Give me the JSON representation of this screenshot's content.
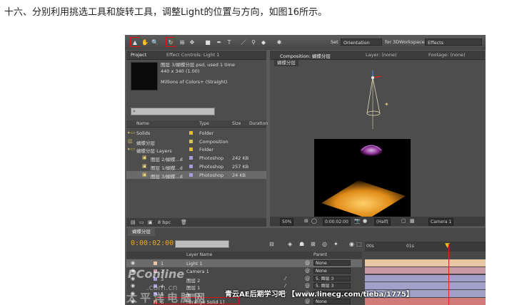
{
  "caption": "十六、分别利用挑选工具和旋转工具，调整Light的位置与方向，如图16所示。",
  "colors": {
    "accent_red": "#e01010",
    "timecode": "#e8a818",
    "layer_light": "#e8c7a4",
    "layer_camera": "#c89aa8",
    "layer_solid": "#d17a7a"
  },
  "toolbar": {
    "tools": [
      {
        "icon": "selection-tool-icon",
        "glyph": "▲",
        "highlighted": true
      },
      {
        "icon": "hand-tool-icon",
        "glyph": "✋",
        "highlighted": false
      },
      {
        "icon": "zoom-tool-icon",
        "glyph": "🔍",
        "highlighted": false
      },
      {
        "icon": "rotation-tool-icon",
        "glyph": "↻",
        "highlighted": true
      },
      {
        "icon": "camera-orbit-icon",
        "glyph": "⊞",
        "highlighted": false
      },
      {
        "icon": "pan-behind-icon",
        "glyph": "✥",
        "highlighted": false
      },
      {
        "icon": "rectangle-tool-icon",
        "glyph": "■",
        "highlighted": false
      },
      {
        "icon": "pen-tool-icon",
        "glyph": "✒",
        "highlighted": false
      },
      {
        "icon": "type-tool-icon",
        "glyph": "T",
        "highlighted": false
      },
      {
        "icon": "brush-tool-icon",
        "glyph": "／",
        "highlighted": false
      },
      {
        "icon": "clone-stamp-icon",
        "glyph": "⚲",
        "highlighted": false
      },
      {
        "icon": "eraser-tool-icon",
        "glyph": "◆",
        "highlighted": false
      },
      {
        "icon": "puppet-tool-icon",
        "glyph": "✱",
        "highlighted": false
      }
    ],
    "set_label": "Set",
    "orientation_value": "Orientation",
    "workspace_label": "for 3DWorkspace:",
    "workspace_value": "Effects"
  },
  "project": {
    "tab_project": "Project",
    "tab_effects": "Effect Controls: Light 1",
    "selected_name": "图层 3/蝴蝶分层.psd",
    "used": ", used 1 time",
    "dims": "440 x 340 (1.00)",
    "colors": "Millions of Colors+ (Straight)",
    "col_name": "Name",
    "col_type": "Type",
    "col_size": "Size",
    "col_duration": "Duration",
    "items": [
      {
        "name": "Solids",
        "type": "Folder",
        "size": "",
        "swatch": "#e0c030"
      },
      {
        "name": "蝴蝶分层",
        "type": "Composition",
        "size": "",
        "swatch": "#d9c35e"
      },
      {
        "name": "蝴蝶分层 Layers",
        "type": "Folder",
        "size": "",
        "swatch": "#e0c030"
      },
      {
        "name": "图层 2/蝴蝶...d",
        "type": "Photoshop",
        "size": "242 KB",
        "swatch": "#a49ed8"
      },
      {
        "name": "图层 1/蝴蝶...d",
        "type": "Photoshop",
        "size": "257 KB",
        "swatch": "#a49ed8"
      },
      {
        "name": "图层 3/蝴蝶...d",
        "type": "Photoshop",
        "size": "24 KB",
        "swatch": "#a49ed8"
      }
    ],
    "bpc": "8 bpc"
  },
  "composition": {
    "tab": "Composition: 蝴蝶分层",
    "layer_tab": "Layer: (none)",
    "footage_tab": "Footage: (none)",
    "button": "蝴蝶分层",
    "zoom": "50%",
    "time": "0:00:02:00",
    "resolution": "(Half)",
    "view": "Camera 1"
  },
  "timeline": {
    "tab": "蝴蝶分层",
    "timecode": "0:00:02:00",
    "col_layer_name": "Layer Name",
    "col_parent": "Parent",
    "ruler": [
      "00s",
      "01s"
    ],
    "layers": [
      {
        "num": "1",
        "name": "Light 1",
        "parent": "None"
      },
      {
        "num": "2",
        "name": "Camera 1",
        "parent": "None"
      },
      {
        "num": "3",
        "name": "图层 2",
        "parent": "5. 图层 3"
      },
      {
        "num": "4",
        "name": "图层 1",
        "parent": "5. 图层 3"
      },
      {
        "num": "5",
        "name": "图层 3",
        "parent": "None"
      },
      {
        "num": "6",
        "name": "[Orange Solid 1]",
        "parent": "None"
      }
    ]
  },
  "watermarks": {
    "pconline": "PConline",
    "site": "太平洋电脑网",
    "domain": ".com.cn",
    "banner": "青云AE后期学习吧 【www.linecg.com/tieba/1775】"
  }
}
